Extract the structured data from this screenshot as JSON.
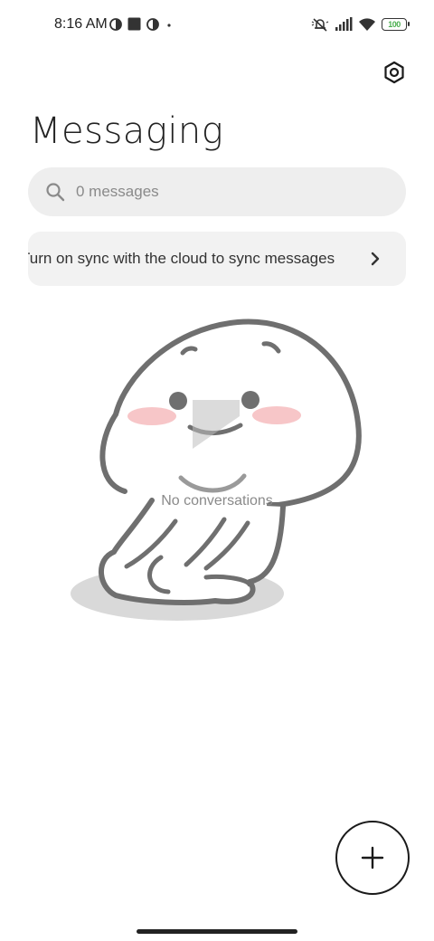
{
  "status_bar": {
    "time": "8:16 AM",
    "left_icons": [
      "data-saver-icon",
      "square-notification-icon",
      "data-saver-icon",
      "more-dot-icon"
    ],
    "right_icons": [
      "silent-icon",
      "signal-icon",
      "wifi-icon",
      "battery-icon"
    ],
    "battery_level": "100"
  },
  "header": {
    "title": "Messaging",
    "settings_icon": "settings-hexagon-icon"
  },
  "search": {
    "placeholder": "0 messages",
    "icon": "search-icon"
  },
  "sync_banner": {
    "text": "Turn on sync with the cloud to sync messages",
    "icon": "chevron-right-icon"
  },
  "empty_state": {
    "label": "No conversations",
    "illustration": "sitting-character-illustration"
  },
  "fab": {
    "icon": "plus-icon"
  },
  "colors": {
    "background": "#ffffff",
    "search_bg": "#eeeeee",
    "banner_bg": "#f2f2f2",
    "muted_text": "#8a8a8a",
    "text": "#222222",
    "blush": "#f7c6c8"
  }
}
